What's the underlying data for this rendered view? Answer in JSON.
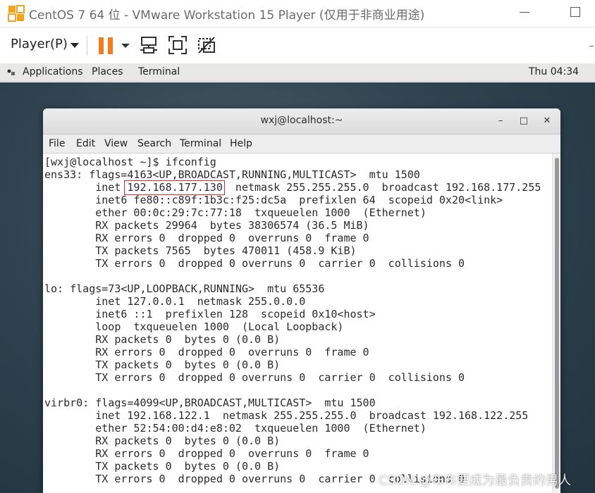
{
  "vm_window": {
    "title": "CentOS 7 64 位 - VMware Workstation 15 Player (仅用于非商业用途)"
  },
  "toolbar": {
    "player_label": "Player(P)",
    "icons": [
      "pause-icon",
      "send-ctrl-alt-del-icon",
      "fullscreen-icon",
      "unity-icon"
    ],
    "accent": "#f47b20"
  },
  "gnome_bar": {
    "applications": "Applications",
    "places": "Places",
    "terminal": "Terminal",
    "clock": "Thu 04:34"
  },
  "terminal": {
    "title": "wxj@localhost:~",
    "menu": [
      "File",
      "Edit",
      "View",
      "Search",
      "Terminal",
      "Help"
    ],
    "lines": [
      "[wxj@localhost ~]$ ifconfig",
      "ens33: flags=4163<UP,BROADCAST,RUNNING,MULTICAST>  mtu 1500",
      "        inet 192.168.177.130  netmask 255.255.255.0  broadcast 192.168.177.255",
      "        inet6 fe80::c89f:1b3c:f25:dc5a  prefixlen 64  scopeid 0x20<link>",
      "        ether 00:0c:29:7c:77:18  txqueuelen 1000  (Ethernet)",
      "        RX packets 29964  bytes 38306574 (36.5 MiB)",
      "        RX errors 0  dropped 0  overruns 0  frame 0",
      "        TX packets 7565  bytes 470011 (458.9 KiB)",
      "        TX errors 0  dropped 0 overruns 0  carrier 0  collisions 0",
      "",
      "lo: flags=73<UP,LOOPBACK,RUNNING>  mtu 65536",
      "        inet 127.0.0.1  netmask 255.0.0.0",
      "        inet6 ::1  prefixlen 128  scopeid 0x10<host>",
      "        loop  txqueuelen 1000  (Local Loopback)",
      "        RX packets 0  bytes 0 (0.0 B)",
      "        RX errors 0  dropped 0  overruns 0  frame 0",
      "        TX packets 0  bytes 0 (0.0 B)",
      "        TX errors 0  dropped 0 overruns 0  carrier 0  collisions 0",
      "",
      "virbr0: flags=4099<UP,BROADCAST,MULTICAST>  mtu 1500",
      "        inet 192.168.122.1  netmask 255.255.255.0  broadcast 192.168.122.255",
      "        ether 52:54:00:d4:e8:02  txqueuelen 1000  (Ethernet)",
      "        RX packets 0  bytes 0 (0.0 B)",
      "        RX errors 0  dropped 0  overruns 0  frame 0",
      "        TX packets 0  bytes 0 (0.0 B)",
      "        TX errors 0  dropped 0 overruns 0  carrier 0  collisions 0"
    ],
    "highlight_color": "#d62c2c"
  },
  "watermark": "CSDN @布布要成为最负责的男人"
}
